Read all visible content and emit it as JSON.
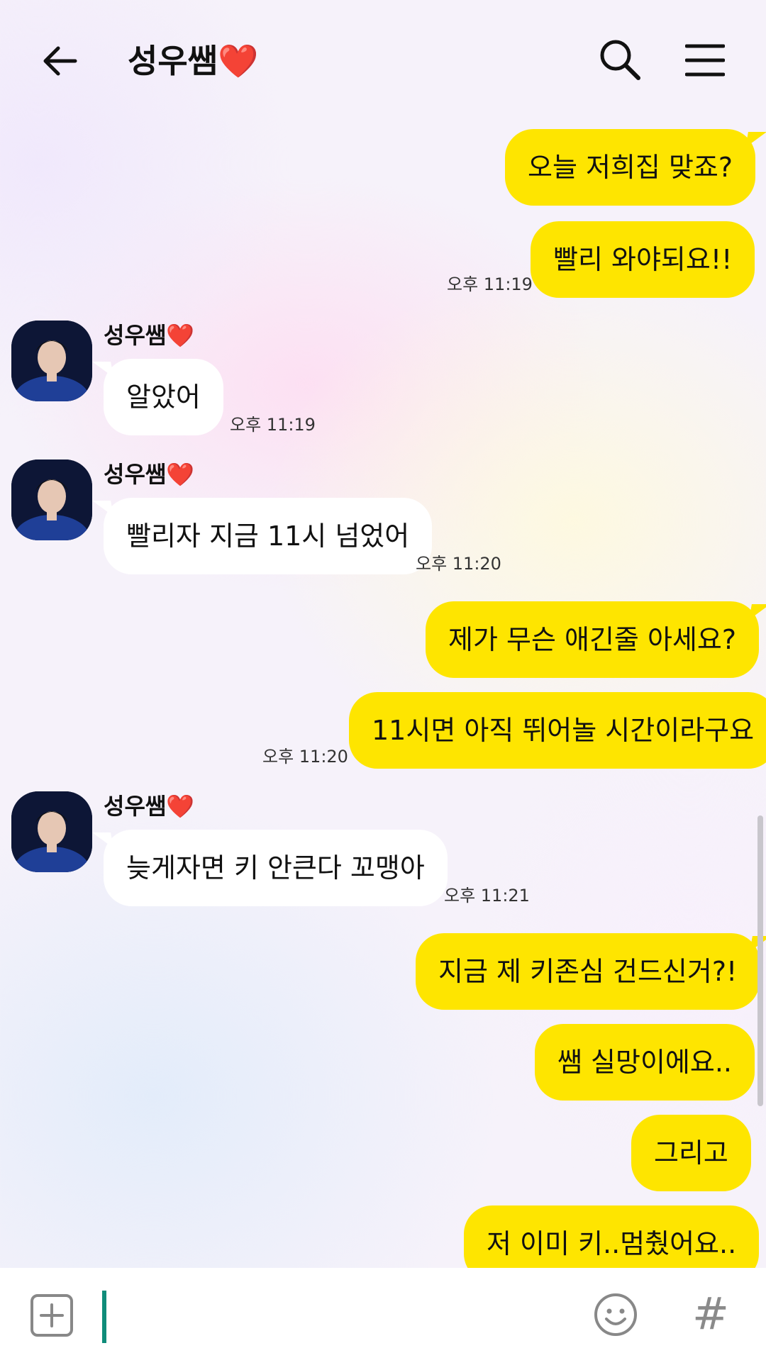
{
  "header": {
    "title": "성우쌤",
    "title_emoji": "❤️",
    "back_icon": "arrow-left-icon",
    "search_icon": "search-icon",
    "menu_icon": "hamburger-menu-icon"
  },
  "messages": [
    {
      "type": "me",
      "text": "오늘 저희집 맞죠?"
    },
    {
      "type": "me",
      "text": "빨리 와야되요!!"
    },
    {
      "type": "time",
      "text": "오후 11:19"
    },
    {
      "type": "sender",
      "name": "성우쌤",
      "emoji": "❤️"
    },
    {
      "type": "them",
      "text": "알았어"
    },
    {
      "type": "time",
      "text": "오후 11:19"
    },
    {
      "type": "sender",
      "name": "성우쌤",
      "emoji": "❤️"
    },
    {
      "type": "them",
      "text": "빨리자 지금 11시 넘었어"
    },
    {
      "type": "time",
      "text": "오후 11:20"
    },
    {
      "type": "me",
      "text": "제가 무슨 애긴줄 아세요?"
    },
    {
      "type": "me",
      "text": "11시면 아직 뛰어놀 시간이라구요"
    },
    {
      "type": "time",
      "text": "오후 11:20"
    },
    {
      "type": "sender",
      "name": "성우쌤",
      "emoji": "❤️"
    },
    {
      "type": "them",
      "text": "늦게자면 키 안큰다 꼬맹아"
    },
    {
      "type": "time",
      "text": "오후 11:21"
    },
    {
      "type": "me",
      "text": "지금 제 키존심 건드신거?!"
    },
    {
      "type": "me",
      "text": "쌤 실망이에요.."
    },
    {
      "type": "me",
      "text": "그리고"
    },
    {
      "type": "me",
      "text": "저 이미 키..멈췄어요.."
    }
  ],
  "input_bar": {
    "add_icon": "plus-square-icon",
    "placeholder": "",
    "emoji_icon": "smiley-icon",
    "hash_label": "#"
  },
  "colors": {
    "my_bubble": "#fee500",
    "their_bubble": "#ffffff",
    "heart": "#e3142e",
    "caret": "#0f8c7a"
  }
}
